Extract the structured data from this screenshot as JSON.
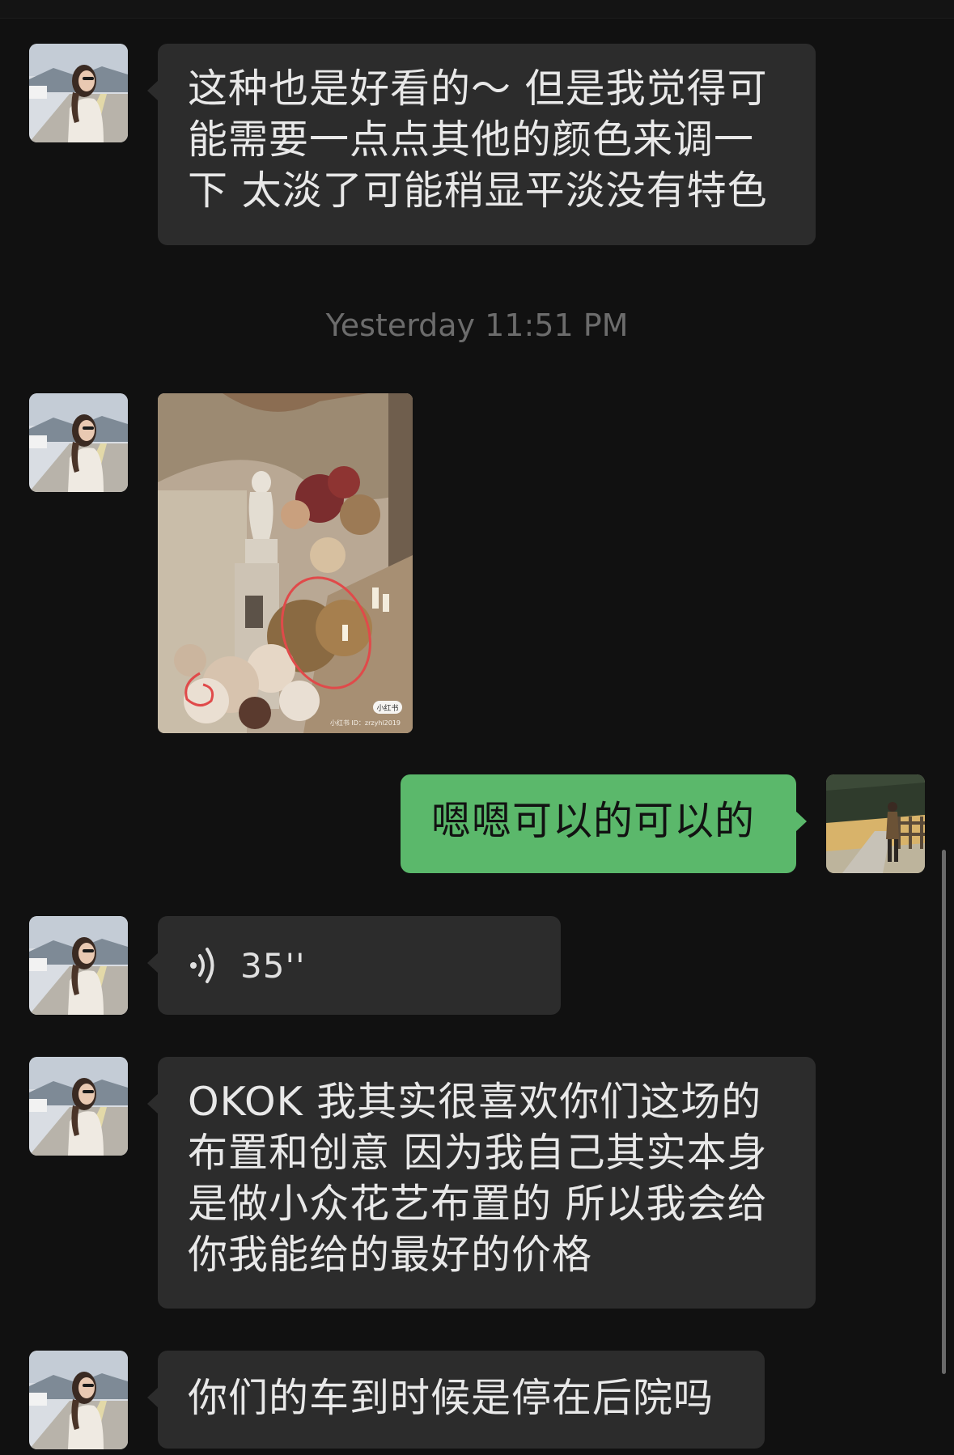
{
  "chat": {
    "timestamp": "Yesterday 11:51 PM",
    "messages": [
      {
        "sender": "contact",
        "type": "text",
        "text": "这种也是好看的～ 但是我觉得可能需要一点点其他的颜色来调一下 太淡了可能稍显平淡没有特色"
      },
      {
        "sender": "contact",
        "type": "image",
        "watermark_badge": "小红书",
        "watermark_id": "小红书 ID：zrzyhl2019"
      },
      {
        "sender": "me",
        "type": "text",
        "text": "嗯嗯可以的可以的"
      },
      {
        "sender": "contact",
        "type": "voice",
        "duration": "35''"
      },
      {
        "sender": "contact",
        "type": "text",
        "text": "OKOK 我其实很喜欢你们这场的布置和创意 因为我自己其实本身是做小众花艺布置的 所以我会给你我能给的最好的价格"
      },
      {
        "sender": "contact",
        "type": "text",
        "text": "你们的车到时候是停在后院吗"
      }
    ]
  },
  "colors": {
    "background": "#111111",
    "incoming_bubble": "#2c2c2c",
    "outgoing_bubble": "#5bb86b",
    "timestamp_text": "#6c6c6c"
  },
  "icons": {
    "voice": "voice-wave-icon"
  }
}
